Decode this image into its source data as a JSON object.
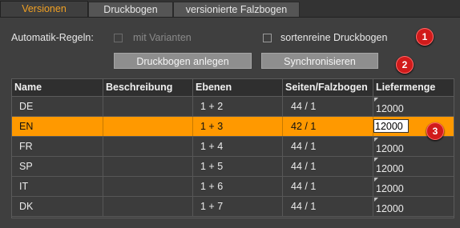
{
  "tabs": [
    {
      "label": "Versionen",
      "active": true
    },
    {
      "label": "Druckbogen",
      "active": false
    },
    {
      "label": "versionierte Falzbogen",
      "active": false
    }
  ],
  "rules": {
    "label": "Automatik-Regeln:",
    "with_variants": {
      "label": "mit Varianten",
      "checked": false,
      "enabled": false
    },
    "sorted_sheets": {
      "label": "sortenreine Druckbogen",
      "checked": false,
      "enabled": true
    }
  },
  "buttons": {
    "create_sheets": "Druckbogen anlegen",
    "synchronize": "Synchronisieren"
  },
  "markers": [
    "1",
    "2",
    "3"
  ],
  "table": {
    "columns": [
      "Name",
      "Beschreibung",
      "Ebenen",
      "Seiten/Falzbogen",
      "Liefermenge"
    ],
    "rows": [
      {
        "name": "DE",
        "description": "",
        "layers": "1 + 2",
        "pages": "44 / 1",
        "quantity": "12000",
        "selected": false
      },
      {
        "name": "EN",
        "description": "",
        "layers": "1 + 3",
        "pages": "42 / 1",
        "quantity": "12000",
        "selected": true
      },
      {
        "name": "FR",
        "description": "",
        "layers": "1 + 4",
        "pages": "44 / 1",
        "quantity": "12000",
        "selected": false
      },
      {
        "name": "SP",
        "description": "",
        "layers": "1 + 5",
        "pages": "44 / 1",
        "quantity": "12000",
        "selected": false
      },
      {
        "name": "IT",
        "description": "",
        "layers": "1 + 6",
        "pages": "44 / 1",
        "quantity": "12000",
        "selected": false
      },
      {
        "name": "DK",
        "description": "",
        "layers": "1 + 7",
        "pages": "44 / 1",
        "quantity": "12000",
        "selected": false
      }
    ]
  },
  "colors": {
    "accent": "#ff9900",
    "active_tab_text": "#f0a023",
    "marker": "#d11b1b"
  }
}
